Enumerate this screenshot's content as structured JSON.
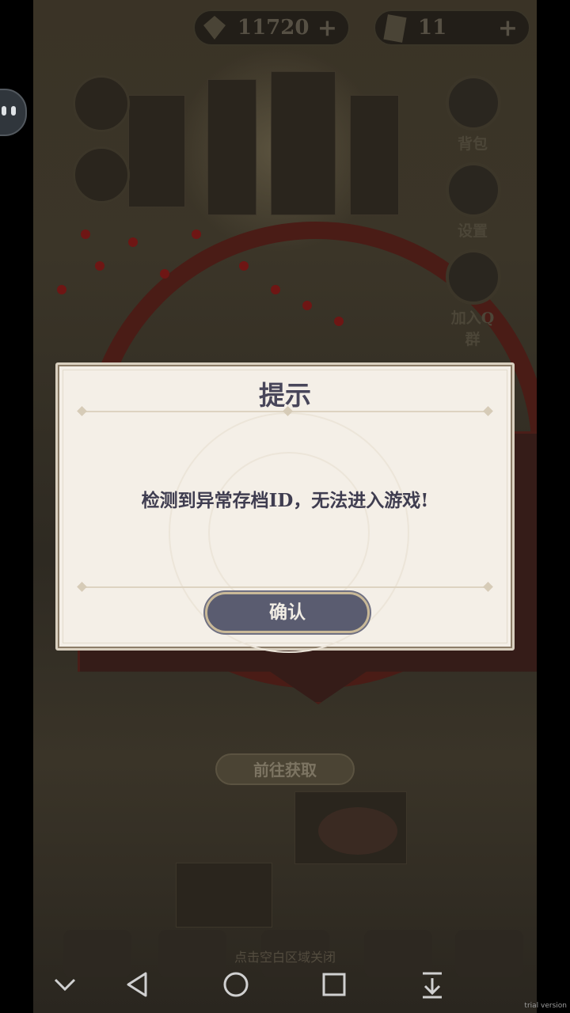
{
  "top_bar": {
    "currency_1": {
      "icon": "gem-icon",
      "value": "11720",
      "plus": "+"
    },
    "currency_2": {
      "icon": "ticket-icon",
      "value": "11",
      "plus": "+"
    }
  },
  "side_menu": [
    {
      "label": "背包",
      "icon": "backpack-icon"
    },
    {
      "label": "设置",
      "icon": "gear-icon"
    },
    {
      "label": "加入Q群",
      "icon": "qq-icon"
    }
  ],
  "background": {
    "get_button": "前往获取",
    "close_hint": "点击空白区域关闭"
  },
  "dialog": {
    "title": "提示",
    "message": "检测到异常存档ID，无法进入游戏!",
    "confirm": "确认"
  },
  "system_nav": [
    "collapse-icon",
    "back-icon",
    "home-icon",
    "recents-icon",
    "download-icon"
  ],
  "watermark": "trial version"
}
